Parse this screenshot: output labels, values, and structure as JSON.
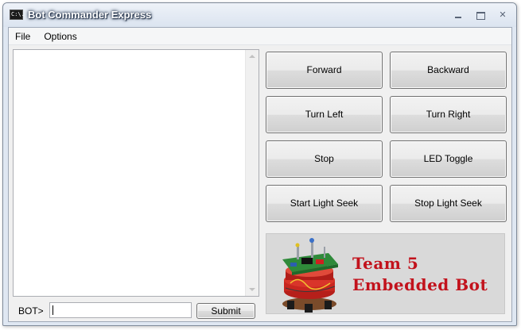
{
  "window": {
    "title": "Bot Commander Express",
    "icon_text": "C:\\."
  },
  "menu": {
    "items": [
      "File",
      "Options"
    ]
  },
  "console": {
    "prompt_label": "BOT>",
    "input_value": "",
    "submit_label": "Submit"
  },
  "controls": {
    "forward": "Forward",
    "backward": "Backward",
    "turn_left": "Turn Left",
    "turn_right": "Turn Right",
    "stop": "Stop",
    "led_toggle": "LED Toggle",
    "start_light_seek": "Start Light Seek",
    "stop_light_seek": "Stop Light Seek"
  },
  "banner": {
    "line1": "Team 5",
    "line2": "Embedded Bot",
    "text_color": "#c2121c"
  },
  "icons": {
    "minimize": "minimize-icon",
    "maximize": "maximize-icon",
    "close": "close-icon",
    "scroll_up": "scroll-up-arrow-icon",
    "scroll_down": "scroll-down-arrow-icon"
  }
}
